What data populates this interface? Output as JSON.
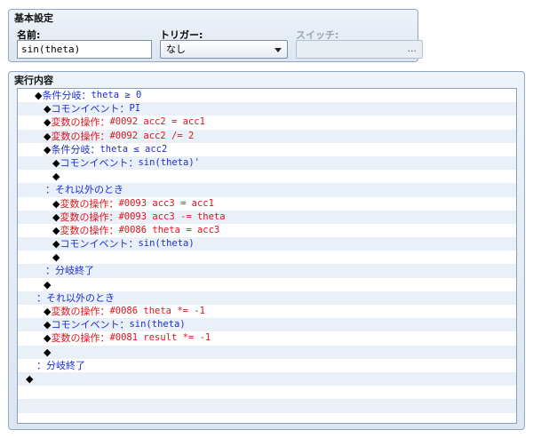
{
  "basic": {
    "title": "基本設定",
    "name_label": "名前:",
    "name_value": "sin(theta)",
    "trigger_label": "トリガー:",
    "trigger_value": "なし",
    "switch_label": "スイッチ:",
    "switch_button": "..."
  },
  "exec": {
    "title": "実行内容",
    "rows": [
      {
        "indent": 0,
        "marker": "◆",
        "label": "条件分岐",
        "text": "theta ≥ 0",
        "color": "blue"
      },
      {
        "indent": 1,
        "marker": "◆",
        "label": "コモンイベント",
        "text": "PI",
        "color": "blue"
      },
      {
        "indent": 1,
        "marker": "◆",
        "label": "変数の操作",
        "text": "#0092 acc2 = acc1",
        "color": "red"
      },
      {
        "indent": 1,
        "marker": "◆",
        "label": "変数の操作",
        "text": "#0092 acc2 /= 2",
        "color": "red"
      },
      {
        "indent": 1,
        "marker": "◆",
        "label": "条件分岐",
        "text": "theta ≤ acc2",
        "color": "blue"
      },
      {
        "indent": 2,
        "marker": "◆",
        "label": "コモンイベント",
        "text": "sin(theta)'",
        "color": "blue"
      },
      {
        "indent": 2,
        "marker": "◆",
        "label": "",
        "text": "",
        "color": "black"
      },
      {
        "indent": 1,
        "marker": "：",
        "label": "それ以外のとき",
        "text": "",
        "color": "blue",
        "branch": true
      },
      {
        "indent": 2,
        "marker": "◆",
        "label": "変数の操作",
        "text": "#0093 acc3 = acc1",
        "color": "red"
      },
      {
        "indent": 2,
        "marker": "◆",
        "label": "変数の操作",
        "text": "#0093 acc3 -= theta",
        "color": "red"
      },
      {
        "indent": 2,
        "marker": "◆",
        "label": "変数の操作",
        "text": "#0086 theta = acc3",
        "color": "red"
      },
      {
        "indent": 2,
        "marker": "◆",
        "label": "コモンイベント",
        "text": "sin(theta)",
        "color": "blue"
      },
      {
        "indent": 2,
        "marker": "◆",
        "label": "",
        "text": "",
        "color": "black"
      },
      {
        "indent": 1,
        "marker": "：",
        "label": "分岐終了",
        "text": "",
        "color": "blue",
        "branch": true
      },
      {
        "indent": 1,
        "marker": "◆",
        "label": "",
        "text": "",
        "color": "black"
      },
      {
        "indent": 0,
        "marker": "：",
        "label": "それ以外のとき",
        "text": "",
        "color": "blue",
        "branch": true
      },
      {
        "indent": 1,
        "marker": "◆",
        "label": "変数の操作",
        "text": "#0086 theta *= -1",
        "color": "red"
      },
      {
        "indent": 1,
        "marker": "◆",
        "label": "コモンイベント",
        "text": "sin(theta)",
        "color": "blue"
      },
      {
        "indent": 1,
        "marker": "◆",
        "label": "変数の操作",
        "text": "#0081 result *= -1",
        "color": "red"
      },
      {
        "indent": 1,
        "marker": "◆",
        "label": "",
        "text": "",
        "color": "black"
      },
      {
        "indent": 0,
        "marker": "：",
        "label": "分岐終了",
        "text": "",
        "color": "blue",
        "branch": true
      },
      {
        "indent": 0,
        "marker": "◆",
        "label": "",
        "text": "",
        "color": "black",
        "root": true
      },
      {
        "indent": 0,
        "marker": "",
        "label": "",
        "text": "",
        "color": "black"
      },
      {
        "indent": 0,
        "marker": "",
        "label": "",
        "text": "",
        "color": "black"
      },
      {
        "indent": 0,
        "marker": "",
        "label": "",
        "text": "",
        "color": "black"
      }
    ]
  },
  "colors": {
    "blue": "#1a2fd6",
    "red": "#e0141d",
    "black": "#000000"
  }
}
